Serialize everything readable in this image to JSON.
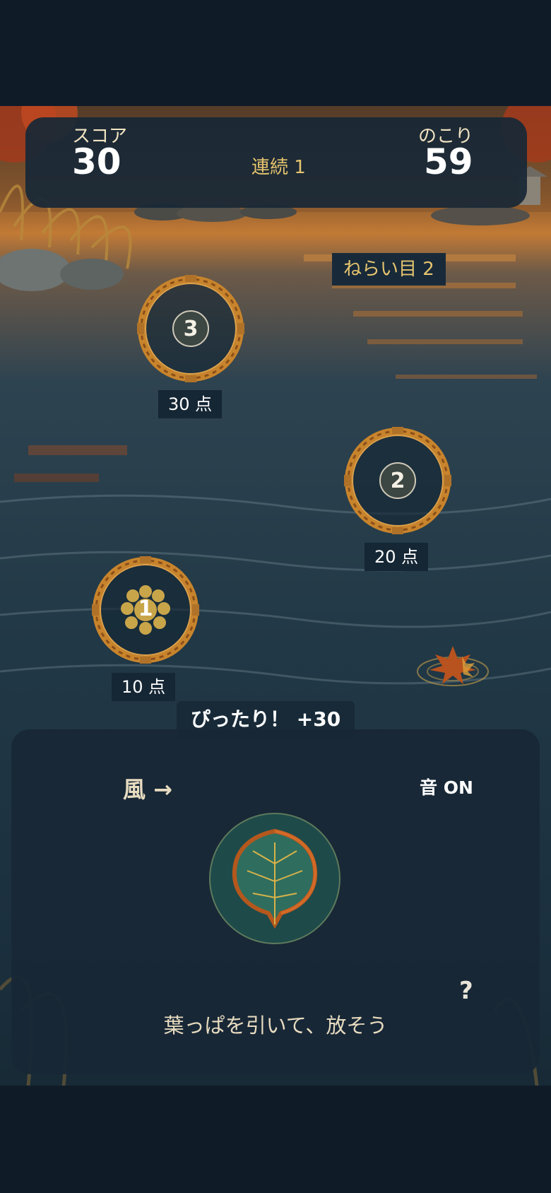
{
  "hud": {
    "score_label": "スコア",
    "score_value": "30",
    "combo_text": "連続 1",
    "remaining_label": "のこり",
    "remaining_value": "59"
  },
  "aim_label": "ねらい目 2",
  "targets": [
    {
      "number": "3",
      "points_label": "30 点"
    },
    {
      "number": "2",
      "points_label": "20 点"
    },
    {
      "number": "1",
      "points_label": "10 点"
    }
  ],
  "feedback": "ぴったり！ +30",
  "controls": {
    "wind": "風 →",
    "sound": "音 ON",
    "help": "?",
    "hint": "葉っぱを引いて、放そう"
  },
  "colors": {
    "background": "#101b28",
    "panel": "#182836",
    "accent_gold": "#e6c46e",
    "text_light": "#f1e3c2"
  },
  "icons": [
    "bamboo-ring-icon",
    "floating-maple-leaf-icon",
    "leaf-icon"
  ]
}
